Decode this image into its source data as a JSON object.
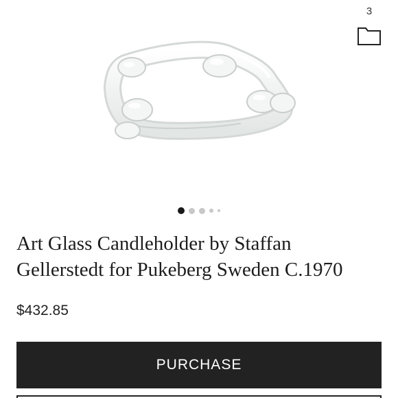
{
  "actions": {
    "save_count": "3"
  },
  "product": {
    "title_line1": "Art Glass Candleholder by Staffan",
    "title_line2": "Gellerstedt for Pukeberg Sweden C.1970",
    "price": "$432.85",
    "purchase_label": "PURCHASE"
  },
  "gallery": {
    "current_image": 1,
    "visible_dots": 5
  },
  "icons": {
    "save": "folder-icon"
  },
  "colors": {
    "button_bg": "#222222",
    "button_text": "#ffffff",
    "dot_active": "#1a1a1a",
    "dot_inactive": "#c8c8c8"
  }
}
